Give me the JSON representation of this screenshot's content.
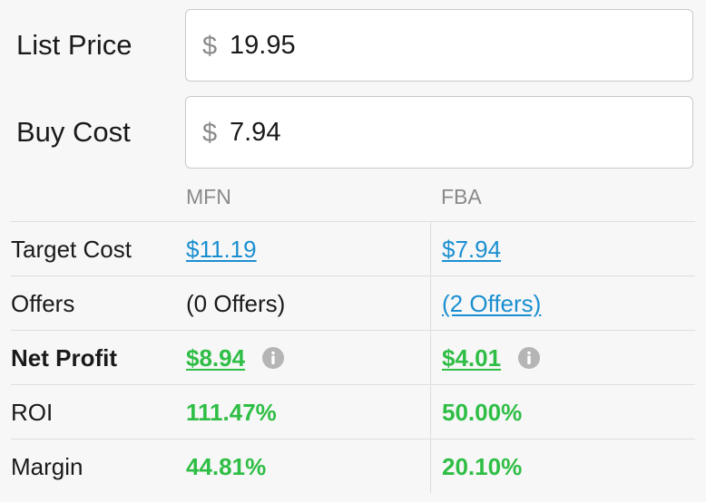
{
  "inputs": {
    "list_price": {
      "label": "List Price",
      "currency": "$",
      "value": "19.95"
    },
    "buy_cost": {
      "label": "Buy Cost",
      "currency": "$",
      "value": "7.94"
    }
  },
  "columns": {
    "mfn": "MFN",
    "fba": "FBA"
  },
  "rows": {
    "target_cost": {
      "label": "Target Cost",
      "mfn": "$11.19",
      "fba": "$7.94"
    },
    "offers": {
      "label": "Offers",
      "mfn": "(0 Offers)",
      "fba": "(2 Offers)"
    },
    "net_profit": {
      "label": "Net Profit",
      "mfn": "$8.94",
      "fba": "$4.01"
    },
    "roi": {
      "label": "ROI",
      "mfn": "111.47%",
      "fba": "50.00%"
    },
    "margin": {
      "label": "Margin",
      "mfn": "44.81%",
      "fba": "20.10%"
    }
  },
  "icons": {
    "info": "info-icon"
  },
  "colors": {
    "link_blue": "#1a8fd0",
    "profit_green": "#2fbe45",
    "muted_gray": "#8a8a8a",
    "info_icon_gray": "#b5b5b5"
  }
}
